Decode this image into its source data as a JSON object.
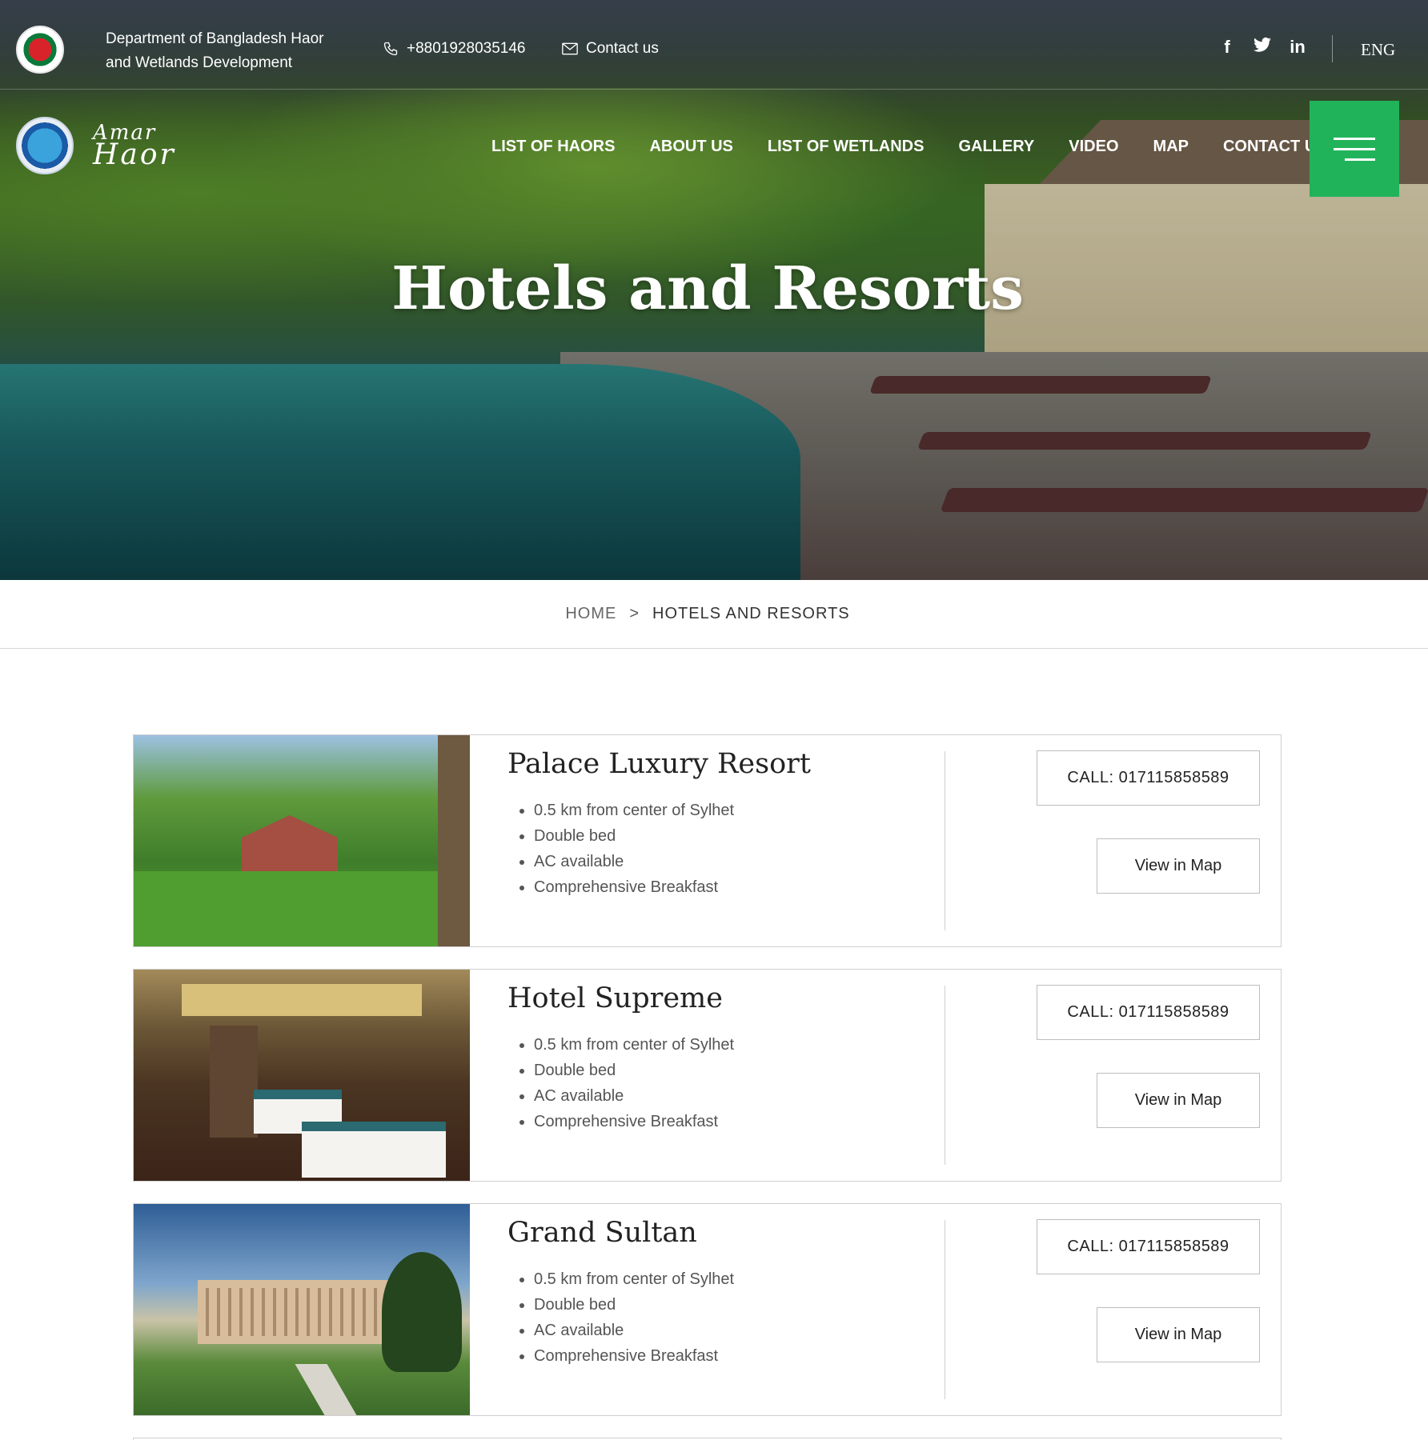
{
  "topbar": {
    "department": "Department of Bangladesh Haor and Wetlands Development",
    "phone": "+8801928035146",
    "contact": "Contact us",
    "socials": [
      "facebook-icon",
      "twitter-icon",
      "linkedin-icon"
    ],
    "language": "ENG"
  },
  "brand": {
    "line1": "Amar",
    "line2": "Haor"
  },
  "nav": {
    "items": [
      "LIST OF HAORS",
      "ABOUT US",
      "LIST OF WETLANDS",
      "GALLERY",
      "VIDEO",
      "MAP",
      "CONTACT US"
    ],
    "menu_icon": "hamburger-icon",
    "menu_color": "#21b35a"
  },
  "hero": {
    "title": "Hotels and Resorts"
  },
  "breadcrumb": {
    "home": "HOME",
    "separator": ">",
    "current": "HOTELS AND RESORTS"
  },
  "hotels": [
    {
      "name": "Palace Luxury Resort",
      "features": [
        "0.5 km from center of Sylhet",
        "Double bed",
        "AC available",
        "Comprehensive Breakfast"
      ],
      "call": "CALL: 017115858589",
      "map": "View in Map"
    },
    {
      "name": "Hotel Supreme",
      "features": [
        "0.5 km from center of Sylhet",
        "Double bed",
        "AC available",
        "Comprehensive Breakfast"
      ],
      "call": "CALL: 017115858589",
      "map": "View in Map"
    },
    {
      "name": "Grand Sultan",
      "features": [
        "0.5 km from center of Sylhet",
        "Double bed",
        "AC available",
        "Comprehensive Breakfast"
      ],
      "call": "CALL: 017115858589",
      "map": "View in Map"
    }
  ]
}
